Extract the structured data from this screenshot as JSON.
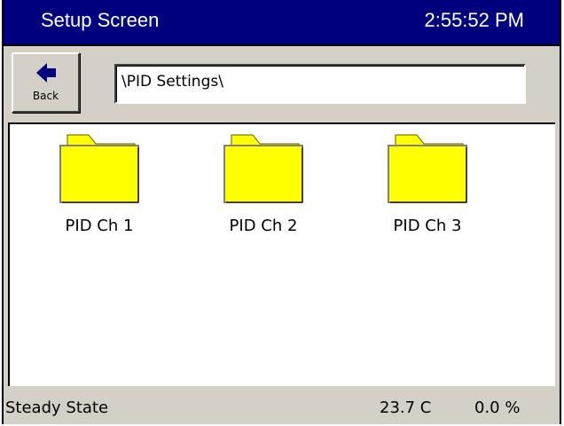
{
  "header": {
    "title": "Setup Screen",
    "time": "2:55:52 PM"
  },
  "toolbar": {
    "back_label": "Back",
    "path": "\\PID Settings\\"
  },
  "folders": [
    {
      "label": "PID Ch 1",
      "icon": "folder-icon"
    },
    {
      "label": "PID Ch 2",
      "icon": "folder-icon"
    },
    {
      "label": "PID Ch 3",
      "icon": "folder-icon"
    }
  ],
  "status": {
    "state": "Steady State",
    "temperature": "23.7 C",
    "output": "0.0 %"
  },
  "colors": {
    "titlebar": "#00007f",
    "folder": "#ffff00",
    "panel": "#d4d0c8"
  }
}
